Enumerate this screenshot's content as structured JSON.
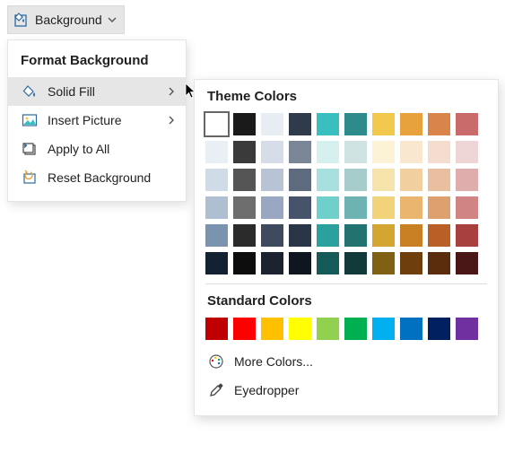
{
  "ribbon": {
    "background_label": "Background"
  },
  "menu": {
    "header": "Format Background",
    "solid_fill": "Solid Fill",
    "insert_picture": "Insert Picture",
    "apply_all": "Apply to All",
    "reset": "Reset Background"
  },
  "flyout": {
    "theme_title": "Theme Colors",
    "standard_title": "Standard Colors",
    "more_colors": "More Colors...",
    "eyedropper": "Eyedropper",
    "theme_rows": [
      [
        "#ffffff",
        "#1a1a1a",
        "#e8ecf3",
        "#2f3b4b",
        "#39bfbf",
        "#2e8b8b",
        "#f2c94c",
        "#e8a23d",
        "#d9844a",
        "#c96b6b"
      ],
      [
        "#e9f0f5",
        "#3a3a3a",
        "#d7dde8",
        "#7a8596",
        "#d6f0ef",
        "#cfe3e3",
        "#fcf2d6",
        "#f9e7cf",
        "#f4ddcf",
        "#efd6d6"
      ],
      [
        "#cfdbe6",
        "#555555",
        "#b9c3d6",
        "#5e6b7e",
        "#a7e0de",
        "#a7cccc",
        "#f7e4ad",
        "#f2cf9f",
        "#e9bf9f",
        "#e0adad"
      ],
      [
        "#aebfd1",
        "#6e6e6e",
        "#9aa7c2",
        "#46536a",
        "#6fd0cb",
        "#6db3b3",
        "#f2d37a",
        "#eab56e",
        "#dda06e",
        "#d08484"
      ],
      [
        "#7a94af",
        "#2b2b2b",
        "#404a5e",
        "#2a3547",
        "#2aa19c",
        "#237272",
        "#d4a531",
        "#c97f24",
        "#b96026",
        "#a94040"
      ],
      [
        "#122233",
        "#0d0d0d",
        "#1b2230",
        "#10161f",
        "#155a58",
        "#123a3a",
        "#806012",
        "#6e3f0d",
        "#5c2d0d",
        "#4a1616"
      ]
    ],
    "standard_colors": [
      "#c00000",
      "#ff0000",
      "#ffc000",
      "#ffff00",
      "#92d050",
      "#00b050",
      "#00b0f0",
      "#0070c0",
      "#002060",
      "#7030a0"
    ]
  }
}
